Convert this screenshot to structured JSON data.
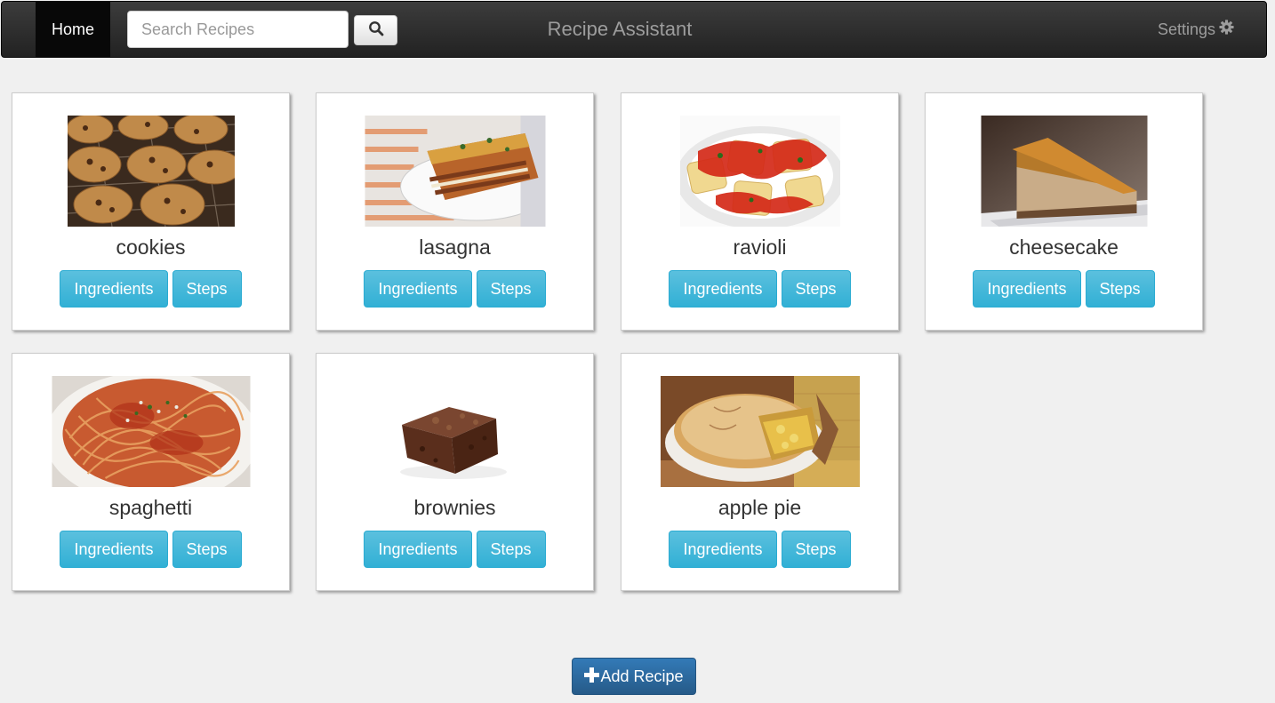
{
  "navbar": {
    "home_label": "Home",
    "search_placeholder": "Search Recipes",
    "brand": "Recipe Assistant",
    "settings_label": "Settings",
    "icons": {
      "search": "search-icon",
      "settings": "gear-icon"
    }
  },
  "recipes": [
    {
      "name": "cookies",
      "ingredients_label": "Ingredients",
      "steps_label": "Steps"
    },
    {
      "name": "lasagna",
      "ingredients_label": "Ingredients",
      "steps_label": "Steps"
    },
    {
      "name": "ravioli",
      "ingredients_label": "Ingredients",
      "steps_label": "Steps"
    },
    {
      "name": "cheesecake",
      "ingredients_label": "Ingredients",
      "steps_label": "Steps"
    },
    {
      "name": "spaghetti",
      "ingredients_label": "Ingredients",
      "steps_label": "Steps"
    },
    {
      "name": "brownies",
      "ingredients_label": "Ingredients",
      "steps_label": "Steps"
    },
    {
      "name": "apple pie",
      "ingredients_label": "Ingredients",
      "steps_label": "Steps"
    }
  ],
  "footer": {
    "add_recipe_label": "Add Recipe",
    "add_icon": "plus-icon"
  },
  "colors": {
    "navbar_bg": "#222222",
    "info_button": "#31b0d5",
    "primary_button": "#286090",
    "page_bg": "#f0f0f0"
  }
}
